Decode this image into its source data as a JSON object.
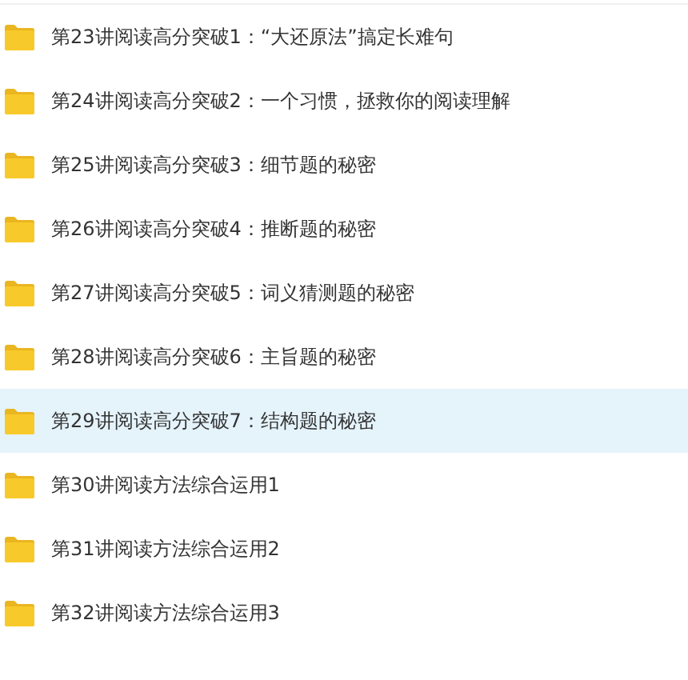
{
  "files": [
    {
      "name": "第23讲阅读高分突破1：“大还原法”搞定长难句",
      "selected": false
    },
    {
      "name": "第24讲阅读高分突破2：一个习惯，拯救你的阅读理解",
      "selected": false
    },
    {
      "name": "第25讲阅读高分突破3：细节题的秘密",
      "selected": false
    },
    {
      "name": "第26讲阅读高分突破4：推断题的秘密",
      "selected": false
    },
    {
      "name": "第27讲阅读高分突破5：词义猜测题的秘密",
      "selected": false
    },
    {
      "name": "第28讲阅读高分突破6：主旨题的秘密",
      "selected": false
    },
    {
      "name": "第29讲阅读高分突破7：结构题的秘密",
      "selected": true
    },
    {
      "name": "第30讲阅读方法综合运用1",
      "selected": false
    },
    {
      "name": "第31讲阅读方法综合运用2",
      "selected": false
    },
    {
      "name": "第32讲阅读方法综合运用3",
      "selected": false
    }
  ]
}
